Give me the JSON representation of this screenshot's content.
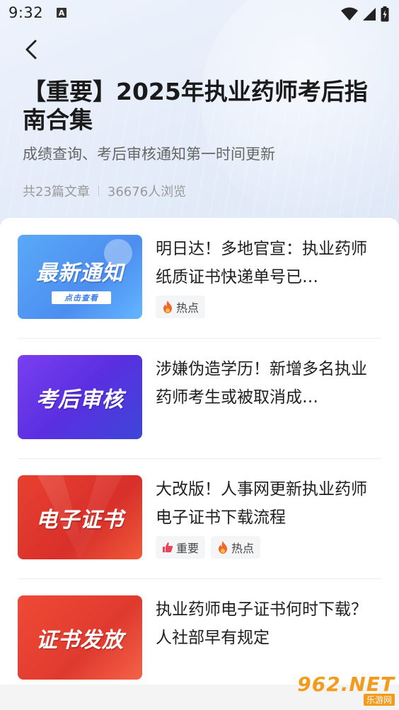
{
  "status_bar": {
    "time": "9:32",
    "notification_icon": "a-icon",
    "wifi_icon": "wifi-icon",
    "signal_icon": "signal-icon",
    "battery_icon": "battery-icon"
  },
  "header": {
    "back_icon": "chevron-left-icon",
    "title": "【重要】2025年执业药师考后指南合集",
    "subtitle": "成绩查询、考后审核通知第一时间更新",
    "article_count": "共23篇文章",
    "view_count": "36676人浏览"
  },
  "articles": [
    {
      "thumb_text": "最新通知",
      "thumb_button": "点击查看",
      "title": "明日达！多地官宣：执业药师纸质证书快递单号已…",
      "tags": [
        {
          "icon": "fire-icon",
          "label": "热点"
        }
      ]
    },
    {
      "thumb_text": "考后审核",
      "title": "涉嫌伪造学历！新增多名执业药师考生或被取消成…",
      "tags": []
    },
    {
      "thumb_text": "电子证书",
      "title": "大改版！人事网更新执业药师电子证书下载流程",
      "tags": [
        {
          "icon": "thumbs-up-icon",
          "label": "重要"
        },
        {
          "icon": "fire-icon",
          "label": "热点"
        }
      ]
    },
    {
      "thumb_text": "证书发放",
      "title": "执业药师电子证书何时下载？人社部早有规定",
      "tags": []
    }
  ],
  "watermark": {
    "big": "962.NET",
    "small": "乐游网"
  },
  "colors": {
    "fire": "#f0662e",
    "thumbs_up": "#e8455a",
    "watermark": "#f29b1d"
  }
}
